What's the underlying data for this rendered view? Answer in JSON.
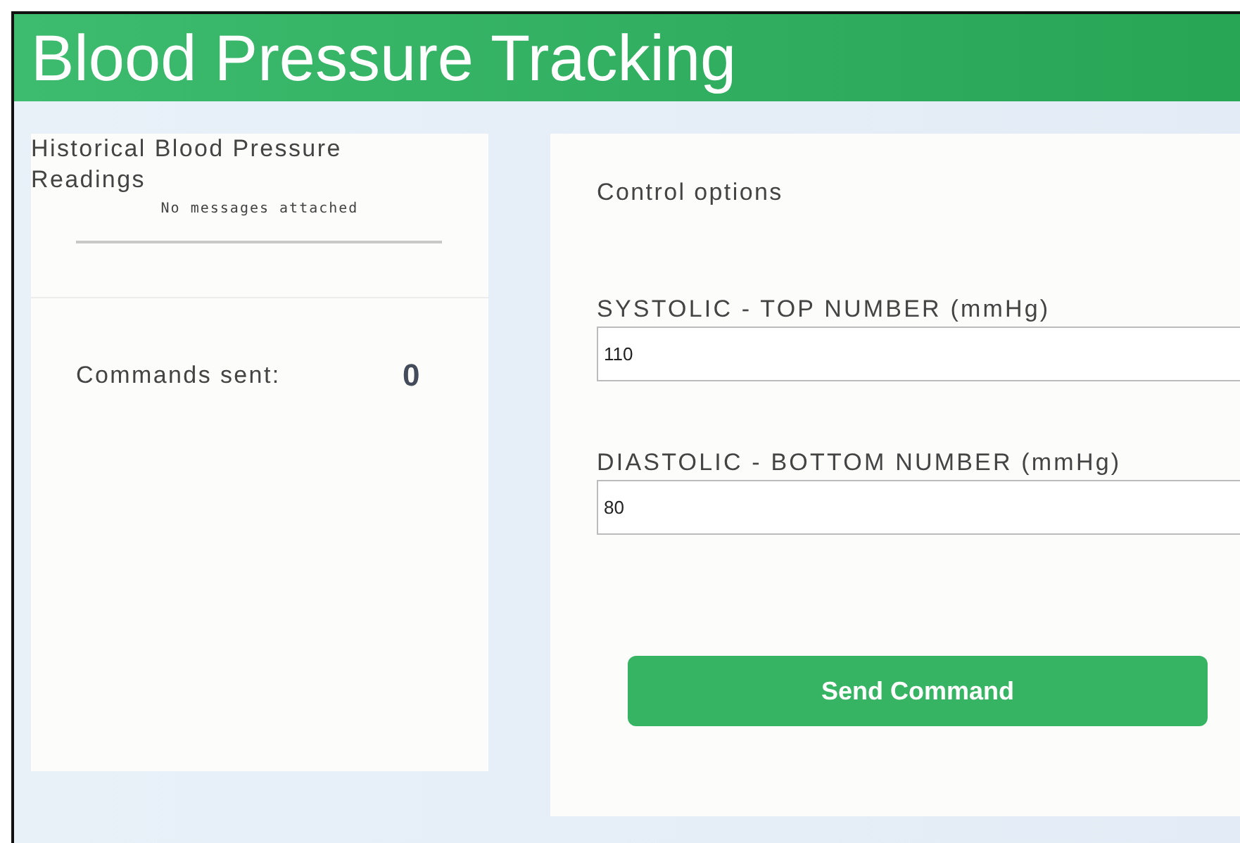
{
  "header": {
    "title": "Blood Pressure Tracking"
  },
  "history": {
    "title": "Historical Blood Pressure Readings",
    "empty_message": "No messages attached",
    "commands_label": "Commands sent:",
    "commands_count": "0"
  },
  "controls": {
    "title": "Control options",
    "fields": [
      {
        "label": "SYSTOLIC - TOP NUMBER (mmHg)",
        "value": "110"
      },
      {
        "label": "DIASTOLIC - BOTTOM NUMBER (mmHg)",
        "value": "80"
      }
    ],
    "button": "Send Command"
  }
}
